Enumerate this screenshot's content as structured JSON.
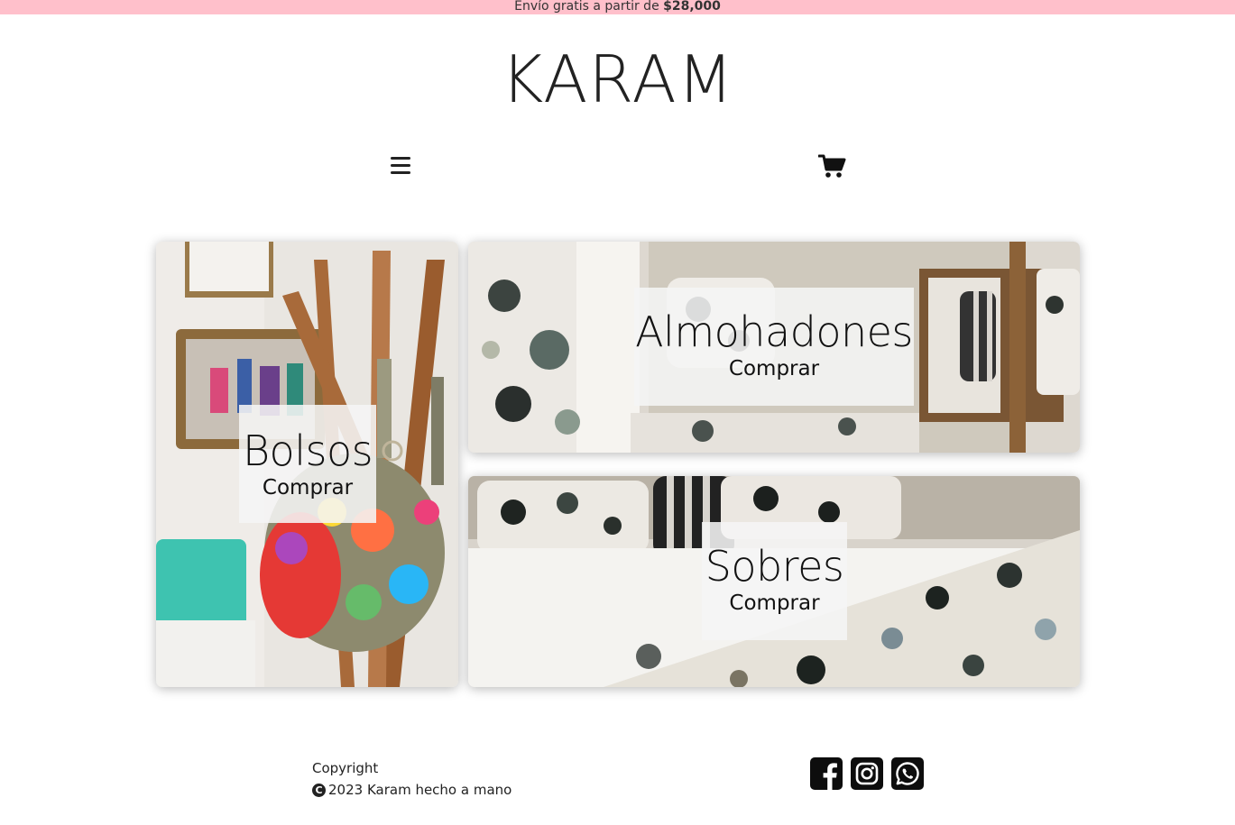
{
  "promo": {
    "text": "Envío gratis a partir de ",
    "amount": "$28,000",
    "background": "#ffc0cb"
  },
  "brand": {
    "name": "KARAM"
  },
  "nav": {
    "menu_icon": "hamburger-menu-icon",
    "cart_icon": "shopping-cart-icon"
  },
  "categories": [
    {
      "title": "Bolsos",
      "cta": "Comprar"
    },
    {
      "title": "Almohadones",
      "cta": "Comprar"
    },
    {
      "title": "Sobres",
      "cta": "Comprar"
    }
  ],
  "footer": {
    "line1": "Copyright",
    "copyright_symbol": "C",
    "line2": "2023 Karam hecho a mano",
    "social": [
      {
        "name": "Facebook",
        "icon": "facebook-icon"
      },
      {
        "name": "Instagram",
        "icon": "instagram-icon"
      },
      {
        "name": "WhatsApp",
        "icon": "whatsapp-icon"
      }
    ]
  }
}
